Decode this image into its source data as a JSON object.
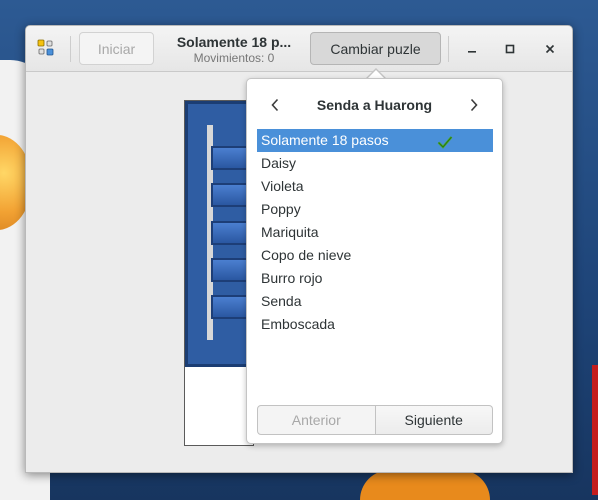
{
  "window": {
    "title": "Solamente 18 p...",
    "subtitle": "Movimientos: 0"
  },
  "toolbar": {
    "start_label": "Iniciar",
    "change_label": "Cambiar puzle"
  },
  "popover": {
    "title": "Senda a Huarong",
    "items": [
      {
        "label": "Solamente 18 pasos",
        "selected": true
      },
      {
        "label": "Daisy"
      },
      {
        "label": "Violeta"
      },
      {
        "label": "Poppy"
      },
      {
        "label": "Mariquita"
      },
      {
        "label": "Copo de nieve"
      },
      {
        "label": "Burro rojo"
      },
      {
        "label": "Senda"
      },
      {
        "label": "Emboscada"
      }
    ],
    "prev_label": "Anterior",
    "next_label": "Siguiente"
  },
  "colors": {
    "selection": "#4a90d9",
    "board_blue": "#2f5da3",
    "check_green": "#4caa2b"
  },
  "icons": {
    "app": "app-grid-icon",
    "minimize": "minimize-icon",
    "maximize": "maximize-icon",
    "close": "close-icon",
    "prev": "chevron-left-icon",
    "next": "chevron-right-icon",
    "check": "checkmark-icon"
  }
}
